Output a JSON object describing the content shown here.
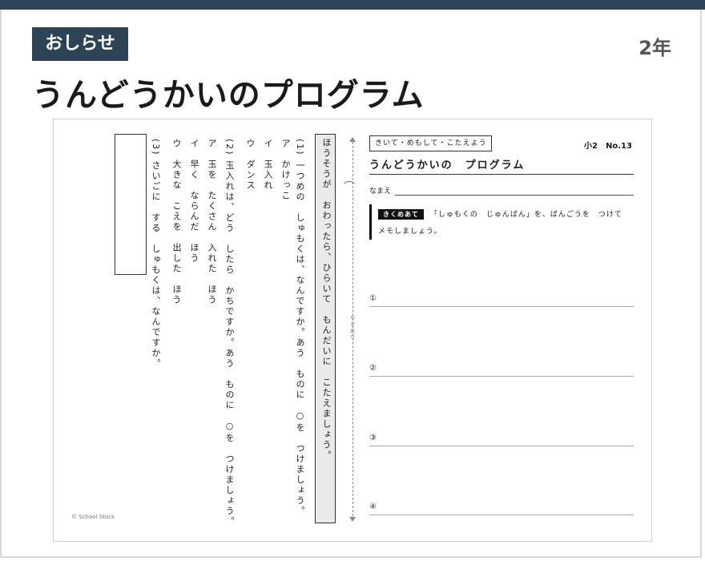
{
  "header": {
    "tag_label": "おしらせ",
    "grade": "2年",
    "title": "うんどうかいのプログラム"
  },
  "worksheet": {
    "instruction": "ほうそうが　おわったら、ひらいて　もんだいに　こたえましょう。",
    "fold_label": "やまおり",
    "q1": {
      "text": "(1) 一つめの　しゅもくは、なんですか。あう　ものに　○を　つけましょう。",
      "options": [
        "ア　かけっこ",
        "イ　玉入れ",
        "ウ　ダンス"
      ]
    },
    "q2": {
      "text": "(2) 玉入れは、どう　したら　かちですか。あう　ものに　○を　つけましょう。",
      "options": [
        "ア　玉を　たくさん　入れた　ほう",
        "イ　早く　ならんだ　ほう",
        "ウ　大きな　こえを　出した　ほう"
      ]
    },
    "q3": {
      "text": "(3) さいごに　する　しゅもくは、なんですか。"
    },
    "copyright": "© School Stock",
    "subject_label": "きいて・めもして・こたえよう",
    "sheet_no": "小2　No.13",
    "sheet_title": "うんどうかいの　プログラム",
    "name_label": "なまえ",
    "goal_tag": "きくめあて",
    "goal_text": "「しゅもくの　じゅんばん」を、ばんごうを　つけて　メモしましょう。",
    "answer_lines": [
      "①",
      "②",
      "③",
      "④"
    ]
  }
}
